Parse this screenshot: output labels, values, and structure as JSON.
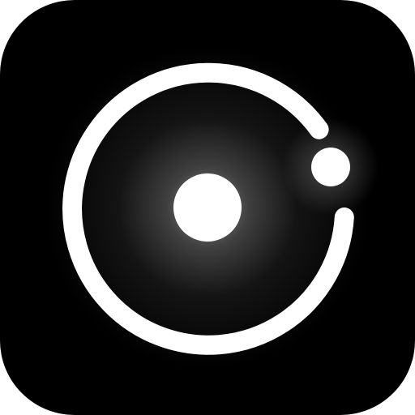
{
  "icon": {
    "name": "orbit-app-icon",
    "colors": {
      "background": "#000000",
      "foreground": "#ffffff",
      "glow": "#ffffff"
    }
  }
}
